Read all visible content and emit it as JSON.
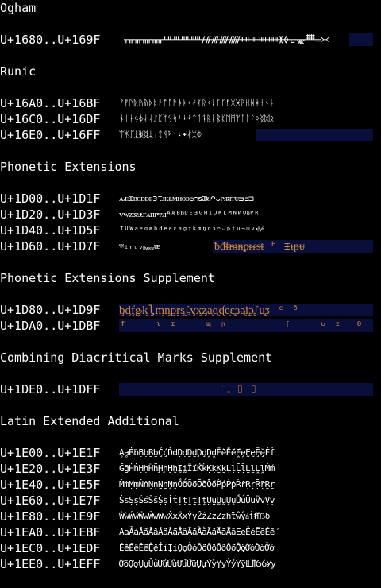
{
  "colors": {
    "background": "#000000",
    "text": "#ffffff",
    "unassigned_block": "#0a0e3a",
    "fallback_glyph": "#d08a3c"
  },
  "headings": {
    "ogham": "Ogham",
    "runic": "Runic",
    "phonetic_ext": "Phonetic Extensions",
    "phonetic_ext_supp": "Phonetic Extensions Supplement",
    "combining_supp": "Combining Diacritical Marks Supplement",
    "latin_ext_add": "Latin Extended Additional"
  },
  "rows": {
    "ogham_0": {
      "range": "U+1680..U+169F",
      "glyphs": " ᚁᚂᚃᚄᚅᚆᚇᚈᚉᚊᚋᚌᚍᚎᚏᚐᚑᚒᚓᚔᚕᚖᚗᚘᚙᚚ᚛᚜"
    },
    "runic_0": {
      "range": "U+16A0..U+16BF",
      "glyphs": "ᚠᚡᚢᚣᚤᚥᚦᚧᚨᚩᚪᚫᚬᚭᚮᚯᚰᚱᚲᚳᚴᚵᚶᚷᚸᚹᚺᚻᚼᚽᚾᚿ"
    },
    "runic_1": {
      "range": "U+16C0..U+16DF",
      "glyphs": "ᛀᛁᛂᛃᛄᛅᛆᛇᛈᛉᛊᛋᛌᛍᛎᛏᛐᛑᛒᛓᛔᛕᛖᛗᛘᛙᛚᛛᛜᛝᛞᛟ"
    },
    "runic_2": {
      "range": "U+16E0..U+16FF",
      "glyphs": "ᛠᛡᛢᛣᛤᛥᛦᛧᛨᛩᛪ᛫᛬᛭ᛮᛯᛰ"
    },
    "phon_0": {
      "range": "U+1D00..U+1D1F",
      "glyphs": "ᴀᴁᴂᴃᴄᴅᴆᴇᴈᴉᴊᴋᴌᴍᴎᴏᴐᴑᴒᴓᴔᴕᴖᴗᴘᴙᴚᴛᴜᴝᴞᴟ"
    },
    "phon_1": {
      "range": "U+1D20..U+1D3F",
      "glyphs": "ᴠᴡᴢᴣᴤᴥᴦᴧᴨᴩᴪᴫᴬᴭᴮᴯᴰᴱᴲᴳᴴᴵᴶᴷᴸᴹᴺᴻᴼᴽᴾᴿ"
    },
    "phon_2": {
      "range": "U+1D40..U+1D5F",
      "glyphs": "ᵀᵁᵂᵃᵄᵅᵆᵇᵈᵉᵊᵋᵌᵍᵎᵏᵐᵑᵒᵓᵔᵕᵖᵗᵘᵙᵚᵛᵜᵝᵞᵟ"
    },
    "phon_3": {
      "range": "U+1D60..U+1D7F",
      "glyphs": "ᵠᵡᵢᵣᵤᵥᵦᵧᵨᵩᵪᵫ",
      "fallback": "ᵬᵭᵮᵯᵰᵱᵲᵳᵴᵵ ᵸ ᵻᵼᵽᵾ"
    },
    "phon_supp_0": {
      "range": "U+1D80..U+1D9F",
      "glyphs": "ᶀᶁᶂᶃᶄᶅᶆᶇᶈᶉᶊᶋᶌᶍᶎᶏᶐᶑᶒᶓᶔᶕᶖᶗᶘᶙᶚ ᶜ ᶞ"
    },
    "phon_supp_1": {
      "range": "U+1DA0..U+1DBF",
      "glyphs": "ᶠ    ᶥ ᶦ    ᶭ ᶮ        ᶴ    ᶹ ᶻ  ᶿ"
    },
    "comb_supp_0": {
      "range": "U+1DE0..U+1DFF",
      "glyphs": "᷾ ᷿ ᷼ ᷽"
    },
    "latin_0": {
      "range": "U+1E00..U+1E1F",
      "glyphs": "ḀḁḂḃḄḅḆḇḈḉḊḋḌḍḎḏḐḑḒḓḔḕḖḗḘḙḚḛḜḝḞḟ"
    },
    "latin_1": {
      "range": "U+1E20..U+1E3F",
      "glyphs": "ḠḡḢḣḤḥḦḧḨḩḪḫḬḭḮḯḰḱḲḳḴḵḶḷḸḹḺḻḼḽḾḿ"
    },
    "latin_2": {
      "range": "U+1E40..U+1E5F",
      "glyphs": "ṀṁṂṃṄṅṆṇṈṉṊṋṌṍṎṏṐṑṒṓṔṕṖṗṘṙṚṛṜṝṞṟ"
    },
    "latin_3": {
      "range": "U+1E60..U+1E7F",
      "glyphs": "ṠṡṢṣṤṥṦṧṨṩṪṫṬṭṮṯṰṱṲṳṴṵṶṷṸṹṺṻṼṽṾṿ"
    },
    "latin_4": {
      "range": "U+1E80..U+1E9F",
      "glyphs": "ẀẁẂẃẄẅẆẇẈẉẊẋẌẍẎẏẐẑẒẓẔẕẖẗẘẙẚẛẜẝẞẟ"
    },
    "latin_5": {
      "range": "U+1EA0..U+1EBF",
      "glyphs": "ẠạẢảẤấẦầẨẩẪẫẬậẮắẰằẲẳẴẵẶặẸẹẺẻẼẽẾế"
    },
    "latin_6": {
      "range": "U+1EC0..U+1EDF",
      "glyphs": "ỀềỂểỄễỆệỈỉỊịỌọỎỏỐốỒồỔổỖỗỘộỚớỜờỞở"
    },
    "latin_7": {
      "range": "U+1EE0..U+1EFF",
      "glyphs": "ỠỡỢợỤụỦủỨứỪừỬửỮữỰựỲỳỴỵỶỷỸỹỺỻỼỽỾỿ"
    }
  }
}
